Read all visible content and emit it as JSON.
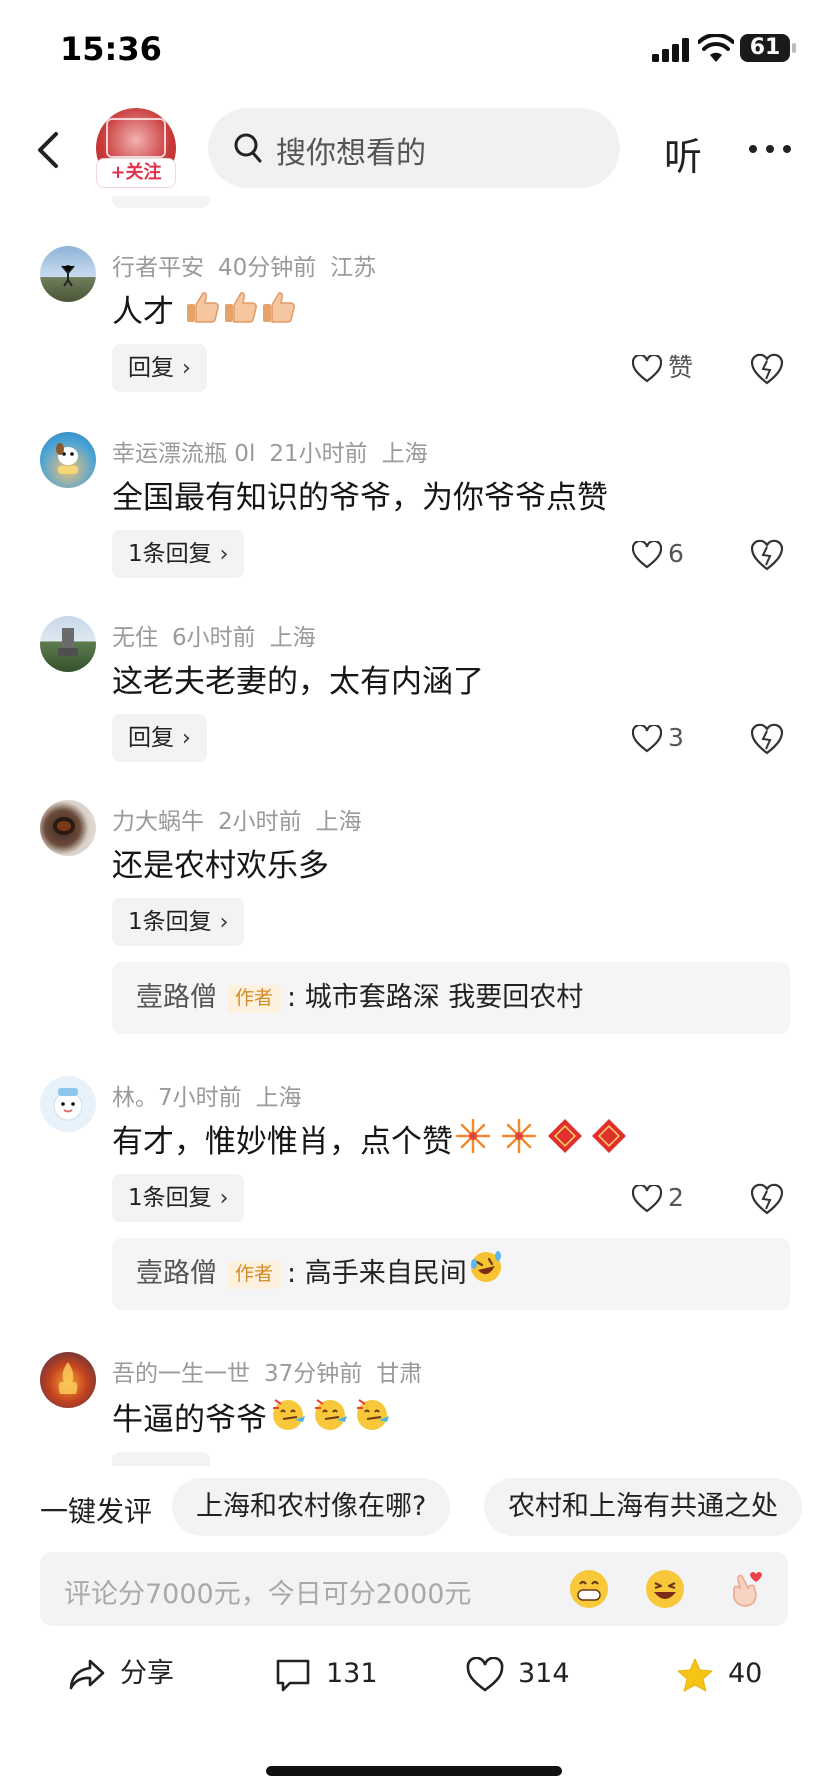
{
  "status_bar": {
    "time": "15:36",
    "battery": "61"
  },
  "header": {
    "follow_label": "+关注",
    "search_placeholder": "搜你想看的",
    "listen_label": "听"
  },
  "comments": [
    {
      "user": "行者平安",
      "time": "40分钟前",
      "location": "江苏",
      "text": "人才",
      "emoji": [
        "thumbs-up",
        "thumbs-up",
        "thumbs-up"
      ],
      "reply_label": "回复",
      "like_label": "赞"
    },
    {
      "user": "幸运漂流瓶 0l",
      "time": "21小时前",
      "location": "上海",
      "text": "全国最有知识的爷爷，为你爷爷点赞",
      "reply_label": "1条回复",
      "like_label": "6"
    },
    {
      "user": "无住",
      "time": "6小时前",
      "location": "上海",
      "text": "这老夫老妻的，太有内涵了",
      "reply_label": "回复",
      "like_label": "3"
    },
    {
      "user": "力大蜗牛",
      "time": "2小时前",
      "location": "上海",
      "text": "还是农村欢乐多",
      "reply_label": "1条回复",
      "sub_reply": {
        "user": "壹路僧",
        "badge": "作者",
        "text": ": 城市套路深 我要回农村"
      }
    },
    {
      "user": "林。7",
      "time": "小时前",
      "location": "上海",
      "text": "有才，惟妙惟肖，点个赞",
      "emoji": [
        "fireworks",
        "fireworks",
        "fu",
        "fu"
      ],
      "reply_label": "1条回复",
      "like_label": "2",
      "sub_reply": {
        "user": "壹路僧",
        "badge": "作者",
        "text": ": 高手来自民间",
        "emoji": [
          "laughing-crying"
        ]
      }
    },
    {
      "user": "吾的一生一世",
      "time": "37分钟前",
      "location": "甘肃",
      "text": "牛逼的爷爷",
      "emoji": [
        "party-face",
        "party-face",
        "party-face"
      ]
    }
  ],
  "quick_comments": {
    "label": "一键发评",
    "chips": [
      "上海和农村像在哪?",
      "农村和上海有共通之处"
    ]
  },
  "comment_input": {
    "placeholder": "评论分7000元，今日可分2000元",
    "emoji": [
      "grin",
      "laugh",
      "finger-heart"
    ]
  },
  "bottom_bar": {
    "share_label": "分享",
    "comments_count": "131",
    "likes_count": "314",
    "favorites_count": "40"
  },
  "colors": {
    "accent_red": "#e0324a",
    "badge_orange": "#d58c2a",
    "star_yellow": "#f6c416"
  }
}
